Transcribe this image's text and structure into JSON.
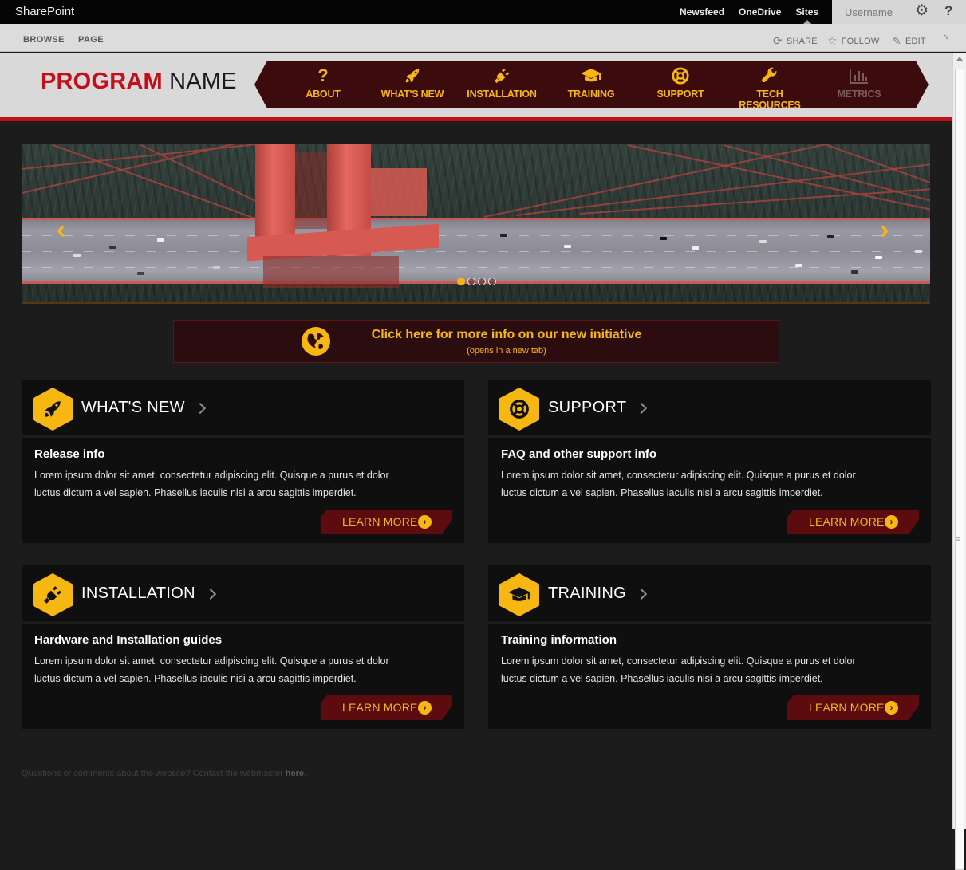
{
  "suite": {
    "brand": "SharePoint",
    "links": [
      "Newsfeed",
      "OneDrive",
      "Sites"
    ],
    "username": "Username"
  },
  "ribbon": {
    "tabs": [
      "BROWSE",
      "PAGE"
    ],
    "share": "SHARE",
    "follow": "FOLLOW",
    "edit": "EDIT"
  },
  "header": {
    "program_first": "PROGRAM",
    "program_second": "NAME"
  },
  "nav": [
    {
      "label": "ABOUT",
      "icon": "question-icon"
    },
    {
      "label": "WHAT'S NEW",
      "icon": "rocket-icon"
    },
    {
      "label": "INSTALLATION",
      "icon": "plug-icon"
    },
    {
      "label": "TRAINING",
      "icon": "graduation-cap-icon"
    },
    {
      "label": "SUPPORT",
      "icon": "lifebuoy-icon"
    },
    {
      "label": "TECH RESOURCES",
      "icon": "wrench-icon"
    },
    {
      "label": "METRICS",
      "icon": "bar-chart-icon"
    }
  ],
  "carousel": {
    "slide_count": 4,
    "active_slide": 1
  },
  "initiative": {
    "title": "Click here for more info on our new initiative",
    "subtitle": "(opens in a new tab)"
  },
  "tiles": [
    {
      "heading": "WHAT'S NEW",
      "icon": "rocket-icon",
      "title": "Release info",
      "line1": "Lorem ipsum dolor sit amet, consectetur adipiscing elit. Quisque a purus et dolor",
      "line2": "luctus dictum a vel sapien. Phasellus iaculis nisi a arcu sagittis imperdiet.",
      "cta": "LEARN MORE"
    },
    {
      "heading": "SUPPORT",
      "icon": "lifebuoy-icon",
      "title": "FAQ and other support info",
      "line1": "Lorem ipsum dolor sit amet, consectetur adipiscing elit. Quisque a purus et dolor",
      "line2": "luctus dictum a vel sapien. Phasellus iaculis nisi a arcu sagittis imperdiet.",
      "cta": "LEARN MORE"
    },
    {
      "heading": "INSTALLATION",
      "icon": "plug-icon",
      "title": "Hardware and Installation guides",
      "line1": "Lorem ipsum dolor sit amet, consectetur adipiscing elit. Quisque a purus et dolor",
      "line2": "luctus dictum a vel sapien. Phasellus iaculis nisi a arcu sagittis imperdiet.",
      "cta": "LEARN MORE"
    },
    {
      "heading": "TRAINING",
      "icon": "graduation-cap-icon",
      "title": "Training information",
      "line1": "Lorem ipsum dolor sit amet, consectetur adipiscing elit. Quisque a purus et dolor",
      "line2": "luctus dictum a vel sapien. Phasellus iaculis nisi a arcu sagittis imperdiet.",
      "cta": "LEARN MORE"
    }
  ],
  "footer": {
    "text": "Questions or comments about the website? Contact the webmaster",
    "link": "here",
    "end": "."
  },
  "colors": {
    "accent": "#f6b712",
    "brand_red": "#c40f1a",
    "nav_bg": "#3b0b0e",
    "tile_bg": "#0f0f0f",
    "page_bg": "#1c1c1c"
  }
}
